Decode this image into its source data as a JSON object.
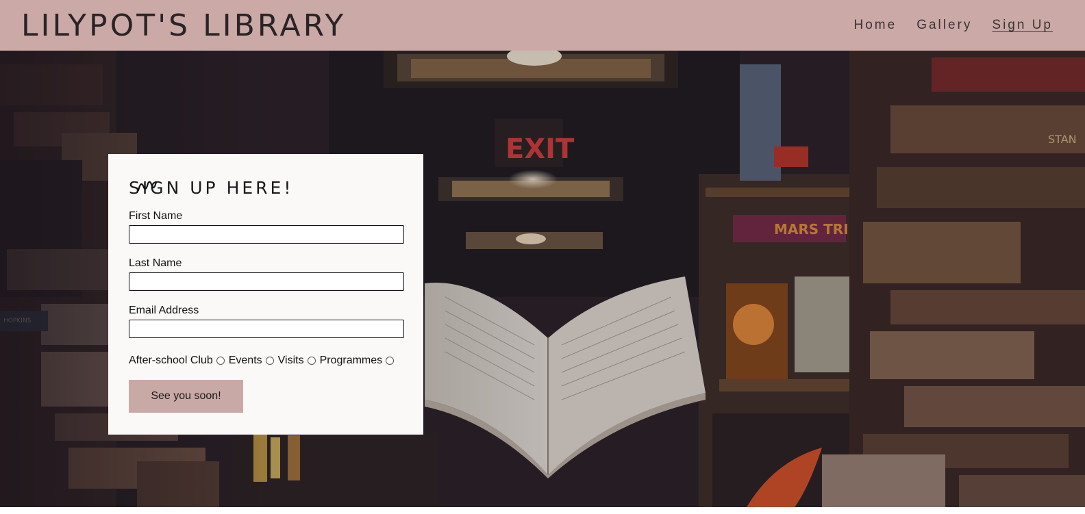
{
  "header": {
    "brand": "LILYPOT'S LIBRARY",
    "nav": [
      "Home",
      "Gallery",
      "Sign Up"
    ],
    "active_nav": "Sign Up"
  },
  "form": {
    "title": "SIGN UP HERE!",
    "fields": {
      "first_name_label": "First Name",
      "first_name_value": "",
      "last_name_label": "Last Name",
      "last_name_value": "",
      "email_label": "Email Address",
      "email_value": ""
    },
    "options": [
      "After-school Club",
      "Events",
      "Visits",
      "Programmes"
    ],
    "submit_label": "See you soon!"
  },
  "colors": {
    "header_bg": "#cba9a6",
    "button_bg": "#c9a9a6",
    "card_bg": "#faf9f8"
  },
  "hero": {
    "scene_text": [
      "EXIT",
      "MARS TRILOGY",
      "STAN",
      "HOPKINS"
    ]
  }
}
